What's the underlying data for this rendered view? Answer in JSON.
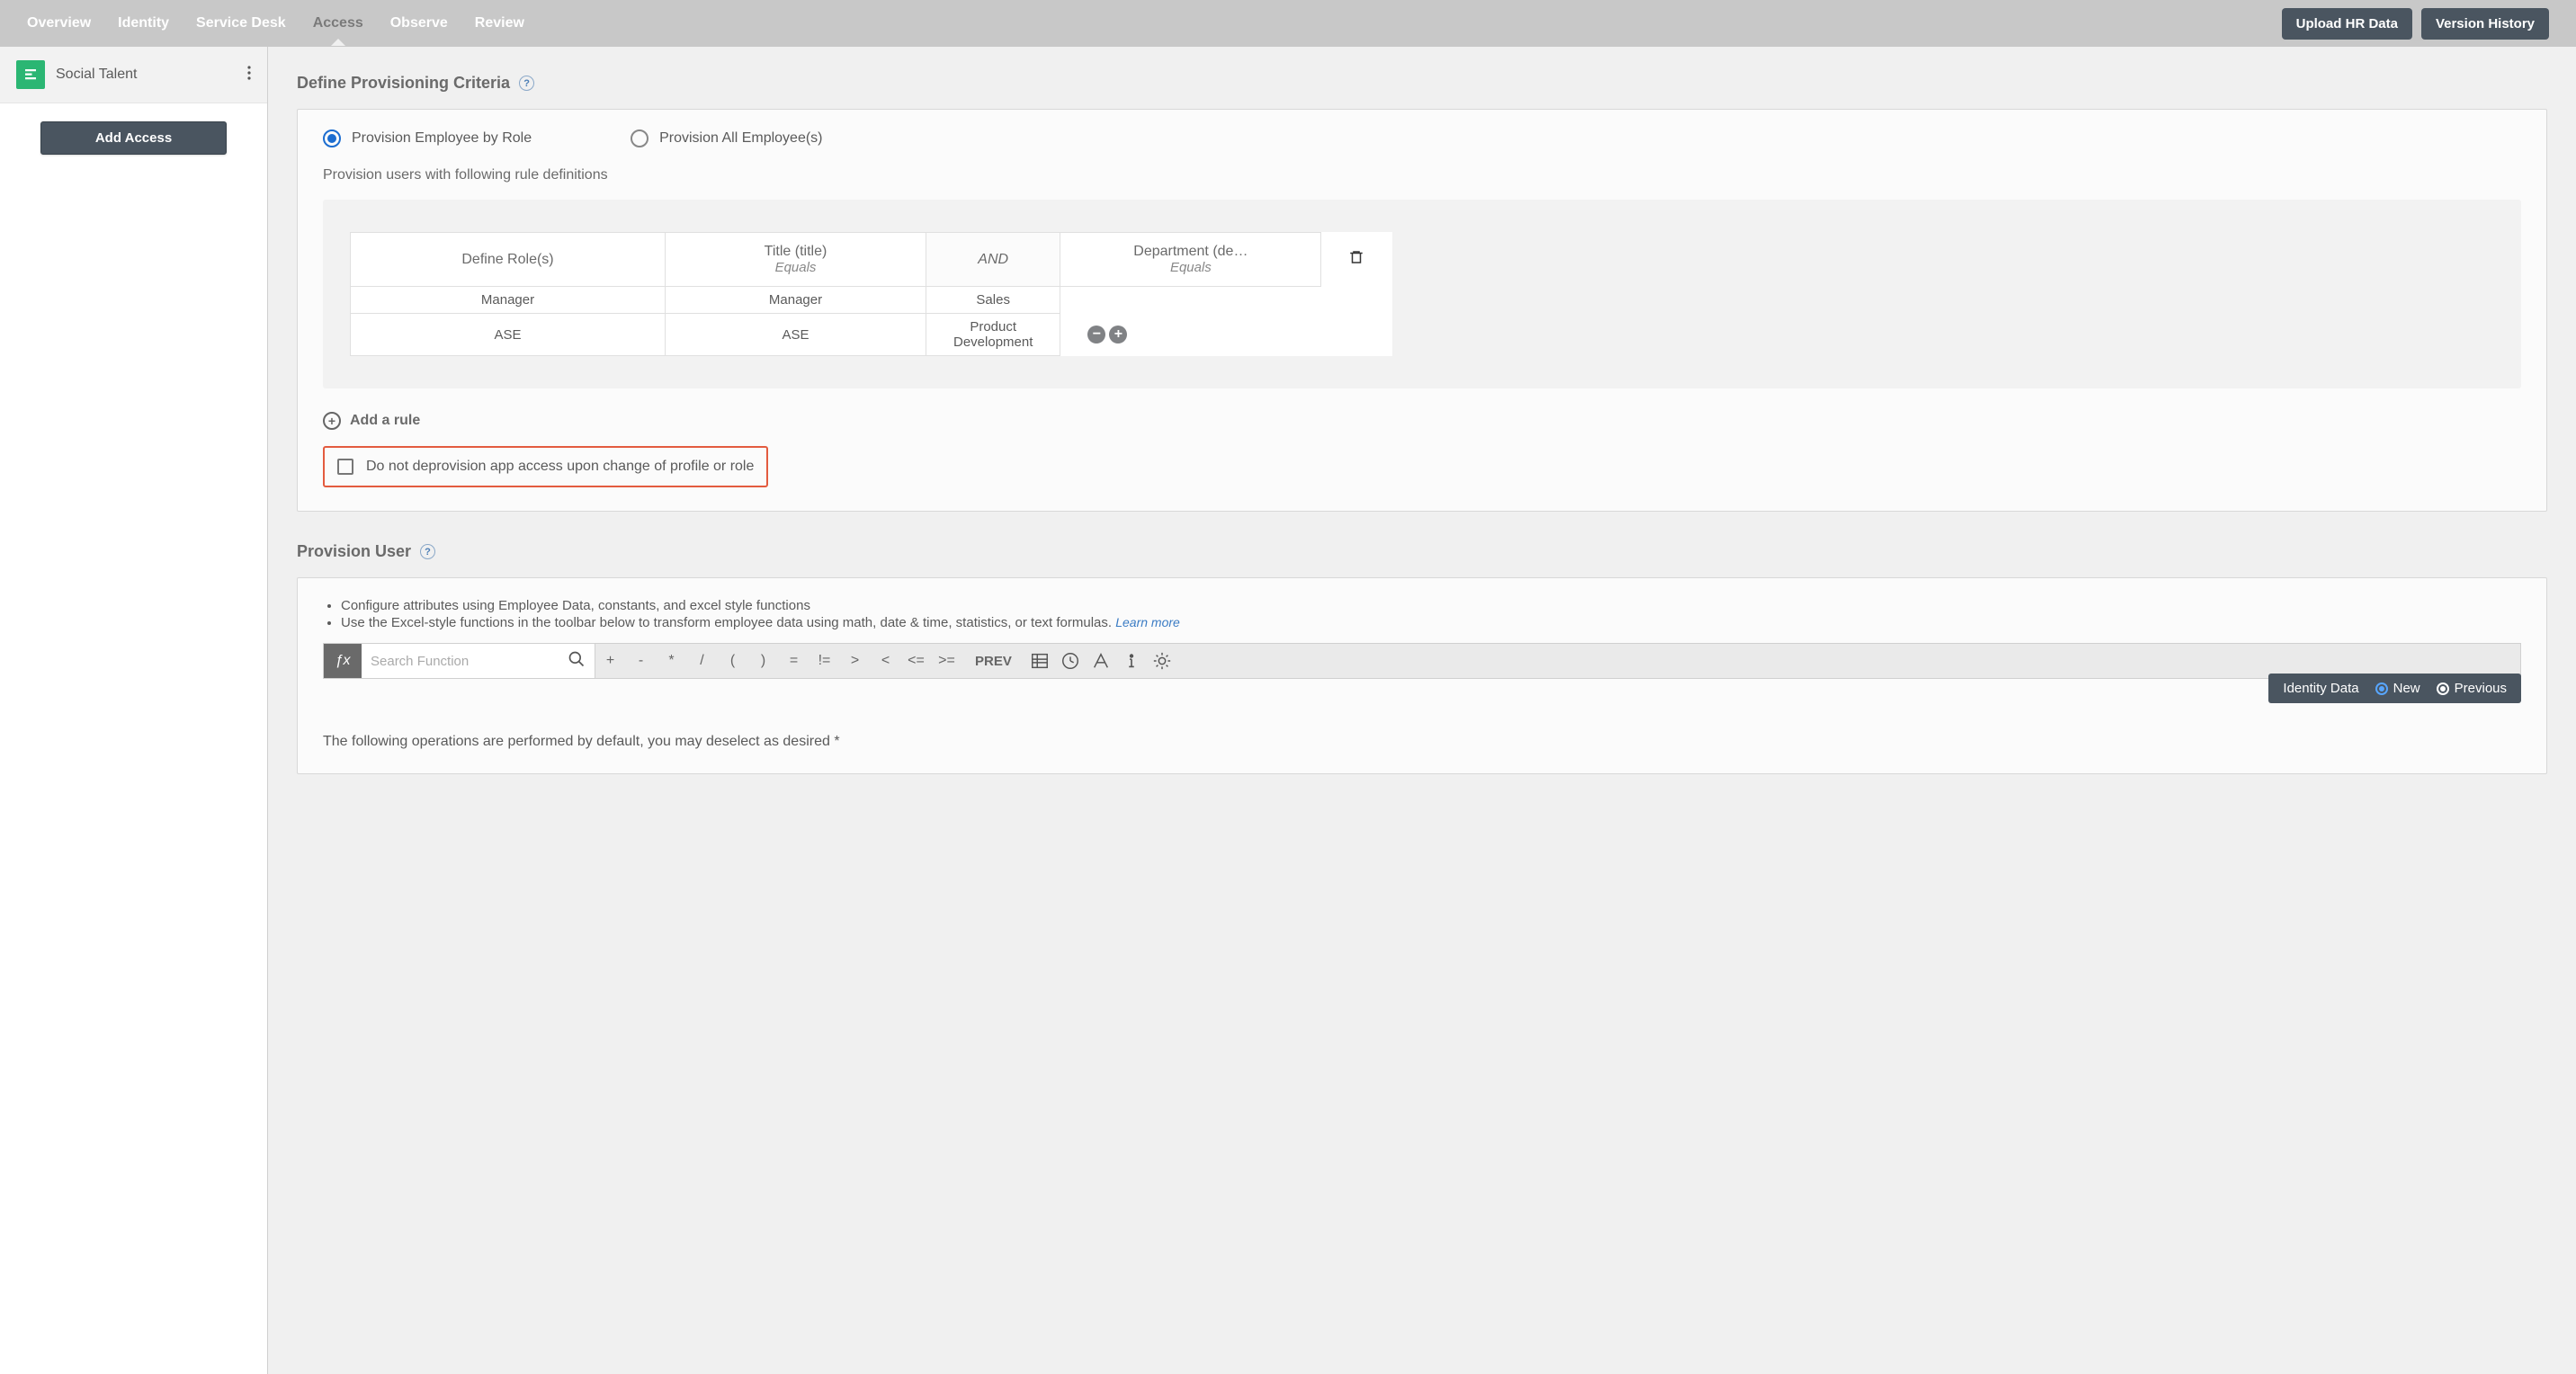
{
  "topnav": {
    "tabs": [
      "Overview",
      "Identity",
      "Service Desk",
      "Access",
      "Observe",
      "Review"
    ],
    "active_index": 3,
    "upload_btn": "Upload HR Data",
    "version_btn": "Version History"
  },
  "sidebar": {
    "app_name": "Social Talent",
    "add_access_btn": "Add Access"
  },
  "section_criteria": {
    "title": "Define Provisioning Criteria",
    "radio_by_role": "Provision Employee by Role",
    "radio_all": "Provision All Employee(s)",
    "rule_desc": "Provision users with following rule definitions",
    "table": {
      "col_role": "Define Role(s)",
      "col_title_top": "Title (title)",
      "col_title_sub": "Equals",
      "and_label": "AND",
      "col_dept_top": "Department (de…",
      "col_dept_sub": "Equals",
      "rows": [
        {
          "role": "Manager",
          "title": "Manager",
          "dept": "Sales"
        },
        {
          "role": "ASE",
          "title": "ASE",
          "dept": "Product Development"
        }
      ]
    },
    "add_rule": "Add a rule",
    "deprovision_checkbox": "Do not deprovision app access upon change of profile or role"
  },
  "section_user": {
    "title": "Provision User",
    "bullet1": "Configure attributes using Employee Data, constants, and excel style functions",
    "bullet2": "Use the Excel-style functions in the toolbar below to transform employee data using math, date & time, statistics, or text formulas.",
    "learn_more": "Learn more",
    "toolbar": {
      "fx": "ƒx",
      "search_placeholder": "Search Function",
      "ops": [
        "+",
        "-",
        "*",
        "/",
        "(",
        ")",
        "=",
        "!=",
        ">",
        "<",
        "<=",
        ">="
      ],
      "prev": "PREV"
    },
    "default_ops_text": "The following operations are performed by default, you may deselect as desired *",
    "identity_bar": {
      "label": "Identity Data",
      "opt_new": "New",
      "opt_prev": "Previous"
    }
  }
}
